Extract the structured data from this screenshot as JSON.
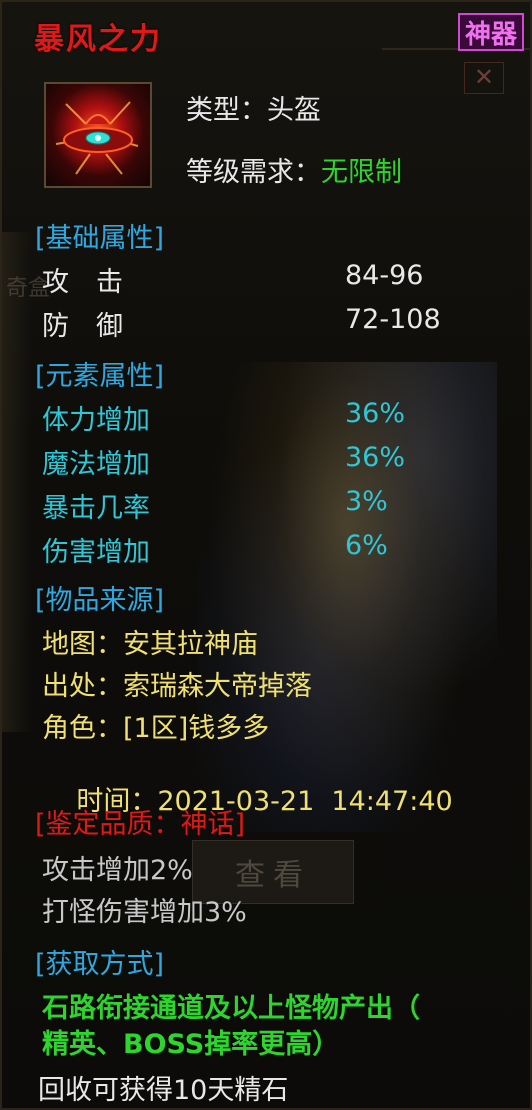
{
  "title": "暴风之力",
  "badge": "神器",
  "background": {
    "button_label": "查看",
    "close_glyph": "✕",
    "side_text": "奇盒"
  },
  "info": {
    "type_label": "类型：",
    "type_value": "头盔",
    "level_label": "等级需求：",
    "level_value": "无限制"
  },
  "basic": {
    "header": "[基础属性]",
    "stats": [
      {
        "name": "攻　击",
        "value": "84-96"
      },
      {
        "name": "防　御",
        "value": "72-108"
      }
    ]
  },
  "element": {
    "header": "[元素属性]",
    "stats": [
      {
        "name": "体力增加",
        "value": "36%"
      },
      {
        "name": "魔法增加",
        "value": "36%"
      },
      {
        "name": "暴击几率",
        "value": "3%"
      },
      {
        "name": "伤害增加",
        "value": "6%"
      }
    ]
  },
  "source": {
    "header": "[物品来源]",
    "lines": [
      {
        "label": "地图：",
        "value": "安其拉神庙"
      },
      {
        "label": "出处：",
        "value": "索瑞森大帝掉落"
      },
      {
        "label": "角色：",
        "value": "[1区]钱多多"
      },
      {
        "label": "时间：",
        "value": "2021-03-21  14:47:40"
      }
    ]
  },
  "quality": {
    "header": "[鉴定品质：神话]",
    "lines": [
      "攻击增加2%",
      "打怪伤害增加3%"
    ]
  },
  "obtain": {
    "header": "[获取方式]",
    "line1": "石路衔接通道及以上怪物产出（",
    "line2": "精英、BOSS掉率更高）",
    "footer": "回收可获得10天精石"
  },
  "colors": {
    "title": "#e01818",
    "badge": "#f070f0",
    "header": "#2fa8e0",
    "element_stat": "#2fc6d6",
    "green": "#2ed52e",
    "source": "#f0e070",
    "quality_header": "#e01818"
  }
}
